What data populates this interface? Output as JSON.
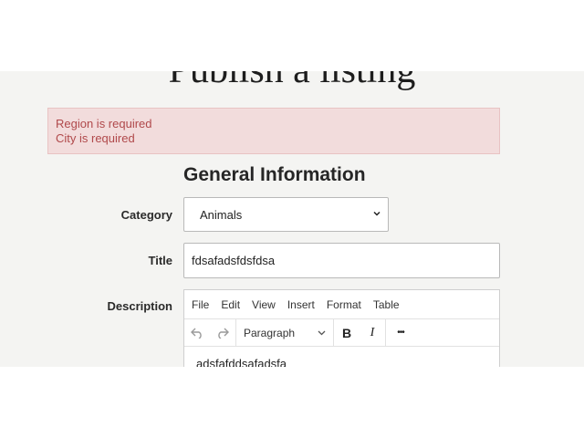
{
  "page": {
    "title": "Publish a listing"
  },
  "errors": [
    "Region is required",
    "City is required"
  ],
  "section": {
    "heading": "General Information"
  },
  "form": {
    "category_label": "Category",
    "category_value": "Animals",
    "title_label": "Title",
    "title_value": "fdsafadsfdsfdsa",
    "description_label": "Description"
  },
  "editor": {
    "menu": [
      "File",
      "Edit",
      "View",
      "Insert",
      "Format",
      "Table"
    ],
    "block_format": "Paragraph",
    "bold": "B",
    "italic": "I",
    "more": "•••",
    "content": "adsfafddsafadsfa",
    "icons": [
      "undo-icon",
      "redo-icon",
      "chevron-down-icon"
    ]
  },
  "colors": {
    "background": "#f4f4f2",
    "error_bg": "#f2dcdc",
    "error_text": "#b0494b"
  }
}
